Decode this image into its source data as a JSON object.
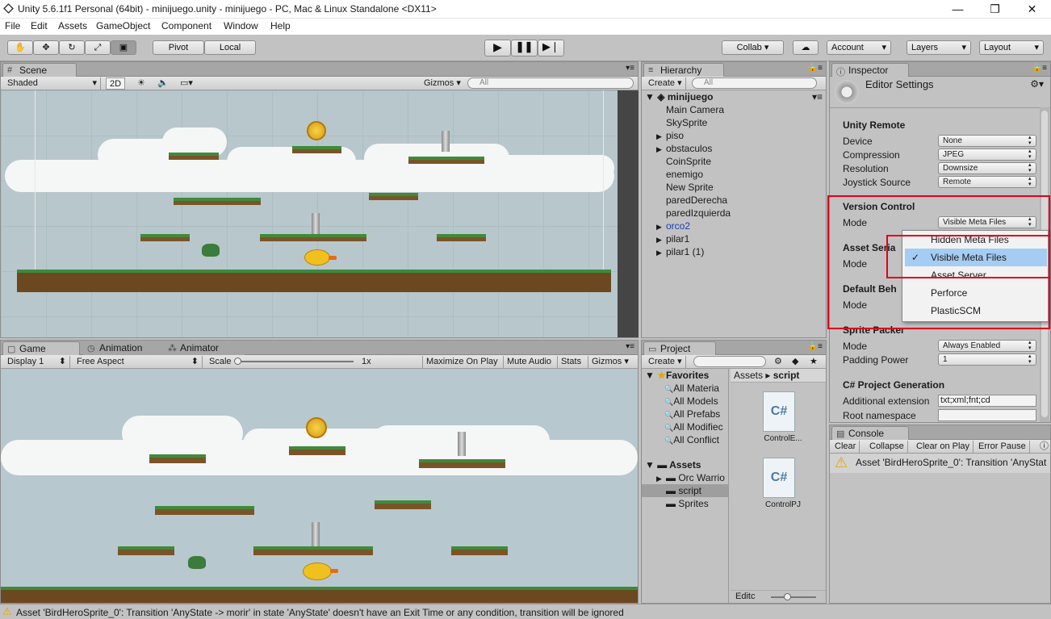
{
  "window": {
    "title": "Unity 5.6.1f1 Personal (64bit) - minijuego.unity - minijuego - PC, Mac & Linux Standalone <DX11>",
    "minimize": "—",
    "maximize": "❐",
    "close": "✕"
  },
  "menu": [
    "File",
    "Edit",
    "Assets",
    "GameObject",
    "Component",
    "Window",
    "Help"
  ],
  "toolbar": {
    "pivot": "Pivot",
    "local": "Local",
    "collab": "Collab ▾",
    "account": "Account",
    "layers": "Layers",
    "layout": "Layout"
  },
  "scene": {
    "tab": "Scene",
    "shading": "Shaded",
    "mode2d": "2D",
    "gizmos": "Gizmos",
    "search_placeholder": "All"
  },
  "game": {
    "tab": "Game",
    "tab_animation": "Animation",
    "tab_animator": "Animator",
    "display": "Display 1",
    "aspect": "Free Aspect",
    "scale_label": "Scale",
    "scale_value": "1x",
    "maximize": "Maximize On Play",
    "mute": "Mute Audio",
    "stats": "Stats",
    "gizmos": "Gizmos"
  },
  "hierarchy": {
    "tab": "Hierarchy",
    "create": "Create",
    "search_placeholder": "All",
    "root": "minijuego",
    "items": [
      {
        "label": "Main Camera",
        "expandable": false
      },
      {
        "label": "SkySprite",
        "expandable": false
      },
      {
        "label": "piso",
        "expandable": true
      },
      {
        "label": "obstaculos",
        "expandable": true
      },
      {
        "label": "CoinSprite",
        "expandable": false
      },
      {
        "label": "enemigo",
        "expandable": false
      },
      {
        "label": "New Sprite",
        "expandable": false
      },
      {
        "label": "paredDerecha",
        "expandable": false
      },
      {
        "label": "paredIzquierda",
        "expandable": false
      },
      {
        "label": "orco2",
        "expandable": true,
        "prefab": true
      },
      {
        "label": "pilar1",
        "expandable": true
      },
      {
        "label": "pilar1 (1)",
        "expandable": true
      }
    ]
  },
  "project": {
    "tab": "Project",
    "create": "Create",
    "favorites": "Favorites",
    "fav_items": [
      "All Materia",
      "All Models",
      "All Prefabs",
      "All Modifiec",
      "All Conflict"
    ],
    "assets": "Assets",
    "asset_folders": [
      "Orc Warrio",
      "script",
      "Sprites"
    ],
    "breadcrumb_root": "Assets",
    "breadcrumb_sep": "▸",
    "breadcrumb_leaf": "script",
    "files": [
      "ControlE...",
      "ControlPJ"
    ],
    "file_icon_text": "C#",
    "footer_field": "Editc"
  },
  "inspector": {
    "tab": "Inspector",
    "title": "Editor Settings",
    "unity_remote": "Unity Remote",
    "rows_remote": [
      {
        "label": "Device",
        "value": "None"
      },
      {
        "label": "Compression",
        "value": "JPEG"
      },
      {
        "label": "Resolution",
        "value": "Downsize"
      },
      {
        "label": "Joystick Source",
        "value": "Remote"
      }
    ],
    "version_control": "Version Control",
    "vc_mode_label": "Mode",
    "vc_mode_value": "Visible Meta Files",
    "asset_serialization": "Asset Seria",
    "asset_mode_label": "Mode",
    "default_behavior": "Default Beh",
    "default_mode_label": "Mode",
    "sprite_packer": "Sprite Packer",
    "sprite_mode_label": "Mode",
    "sprite_mode_value": "Always Enabled",
    "padding_label": "Padding Power",
    "padding_value": "1",
    "csharp_gen": "C# Project Generation",
    "ext_label": "Additional extension",
    "ext_value": "txt;xml;fnt;cd",
    "root_ns_label": "Root namespace"
  },
  "dropdown_menu": {
    "options": [
      {
        "label": "Hidden Meta Files",
        "selected": false
      },
      {
        "label": "Visible Meta Files",
        "selected": true
      },
      {
        "label": "Asset Server",
        "selected": false
      },
      {
        "label": "Perforce",
        "selected": false
      },
      {
        "label": "PlasticSCM",
        "selected": false
      }
    ],
    "check": "✓",
    "highlight_color": "#a5ccf2",
    "annotation_color": "#e0001b"
  },
  "console": {
    "tab": "Console",
    "buttons": [
      "Clear",
      "Collapse",
      "Clear on Play",
      "Error Pause"
    ],
    "message": "Asset 'BirdHeroSprite_0': Transition 'AnyStat"
  },
  "status_bar": {
    "message": "Asset 'BirdHeroSprite_0': Transition 'AnyState -> morir' in state 'AnyState' doesn't have an Exit Time or any condition, transition will be ignored"
  }
}
